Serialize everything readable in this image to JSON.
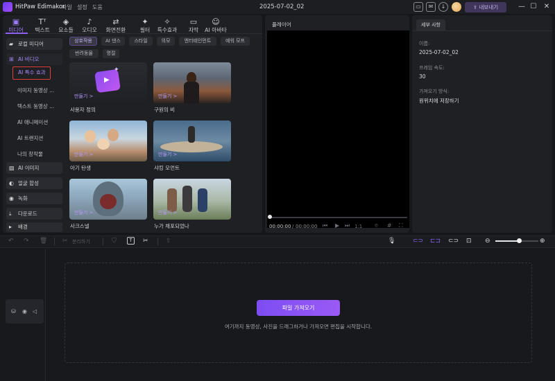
{
  "app": {
    "name": "HitPaw Edimakor",
    "menu": [
      "파일",
      "설정",
      "도움"
    ],
    "project_title": "2025-07-02_02",
    "export_label": "내보내기"
  },
  "media_tabs": [
    {
      "icon": "folder-icon",
      "glyph": "▣",
      "label": "미디어",
      "active": true
    },
    {
      "icon": "text-icon",
      "glyph": "Tᵀ",
      "label": "텍스트"
    },
    {
      "icon": "elements-icon",
      "glyph": "◈",
      "label": "요소들"
    },
    {
      "icon": "audio-icon",
      "glyph": "♪",
      "label": "오디오"
    },
    {
      "icon": "transition-icon",
      "glyph": "⇄",
      "label": "화면전환"
    },
    {
      "icon": "filter-icon",
      "glyph": "✦",
      "label": "필터"
    },
    {
      "icon": "effects-icon",
      "glyph": "✧",
      "label": "특수효과"
    },
    {
      "icon": "subtitle-icon",
      "glyph": "▭",
      "label": "자막"
    },
    {
      "icon": "ai-avatar-icon",
      "glyph": "☺",
      "label": "AI 아바타"
    }
  ],
  "sidebar": {
    "local_media": "로컬 미디어",
    "ai_video": "AI 비디오",
    "ai_video_items": [
      "AI 특수 효과",
      "이미지 동영상 ...",
      "텍스트 동영상 ...",
      "AI 애니메이션",
      "AI 트랜지션",
      "나의 창작물"
    ],
    "ai_image": "AI 이미지",
    "face_swap": "얼굴 합성",
    "record": "녹화",
    "download": "다운로드",
    "background": "배경"
  },
  "chips": [
    "상호작용",
    "AI 댄스",
    "스타일",
    "의모",
    "엔터테인먼트",
    "예워 모프",
    "반려동물",
    "명절"
  ],
  "cards": [
    {
      "action": "만들기 >",
      "label": "사용자 정의"
    },
    {
      "action": "만들기 >",
      "label": "구원의 비"
    },
    {
      "action": "만들기 >",
      "label": "아기 탄생"
    },
    {
      "action": "만들기 >",
      "label": "샤킹 모먼트"
    },
    {
      "action": "만들기 >",
      "label": "사크스넬"
    },
    {
      "action": "만들기 >",
      "label": "누가 채포되었나"
    }
  ],
  "player": {
    "title": "플레이어",
    "time_current": "00:00:00",
    "time_sep": "/",
    "time_total": "00:00:00",
    "speed": "1:1"
  },
  "details": {
    "tab": "세부 사항",
    "name_label": "이름:",
    "name_value": "2025-07-02_02",
    "fps_label": "프레임 속도:",
    "fps_value": "30",
    "import_label": "가져오기 방식:",
    "import_value": "원위치에 저장하기"
  },
  "timeline": {
    "split_label": "분리하기",
    "import_button": "파일 가져오기",
    "hint": "여기까지 동영상, 사진을 드래그하거나 가져오면 편집을 시작합니다.",
    "zoom_percent": 55
  }
}
